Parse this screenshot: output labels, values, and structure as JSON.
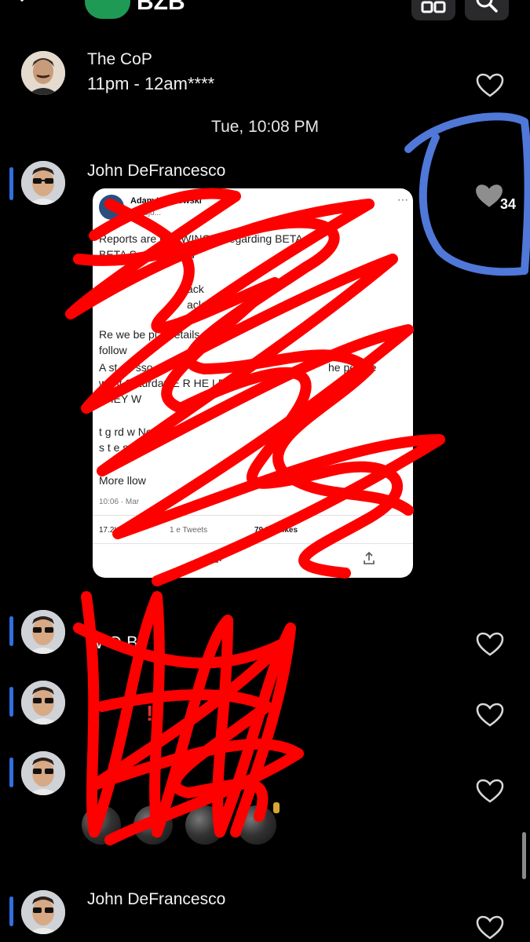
{
  "header": {
    "title": "BZB",
    "icons": [
      "back-chevron-icon",
      "group-avatar",
      "gallery-icon",
      "search-icon"
    ]
  },
  "messages": [
    {
      "sender": "The CoP",
      "text": "11pm - 12am****",
      "liked": false
    },
    {
      "timestamp": "Tue, 10:08 PM"
    },
    {
      "sender": "John DeFrancesco",
      "tweet": {
        "author": "Adam Wojnowski",
        "handle": "@wojo...",
        "lines": [
          "Reports are FLOWING in regarding BETA",
          "BETA Saturday and",
          "ack",
          "ack",
          "Re     we    be        pl    ss   etails to",
          "follow",
          "A st    e      f      sso   ",
          "   he people",
          "want Saturday   E R   HE     LE W",
          "THEY W",
          "   t     g     rd         w           Not",
          "s    t         e     s",
          "More     llow",
          "10:06 · Mar",
          "17.2K Re",
          "1          e Tweets",
          "79.5K Likes"
        ]
      },
      "like_count": "34",
      "liked": true
    },
    {
      "sender": "John DeFrancesco",
      "text": "W     O   B",
      "liked": false
    },
    {
      "sender": "John DeFrancesco",
      "text": "!",
      "liked": false
    },
    {
      "sender": "John DeFrancesco",
      "text": "",
      "emoji": "bomb x4",
      "liked": false
    },
    {
      "sender": "John DeFrancesco",
      "text": "",
      "liked": false
    }
  ],
  "colors": {
    "background": "#000000",
    "unread_indicator": "#2f6fe0",
    "scribble_red": "#ff0000",
    "annotation_blue": "#4f78d8"
  }
}
